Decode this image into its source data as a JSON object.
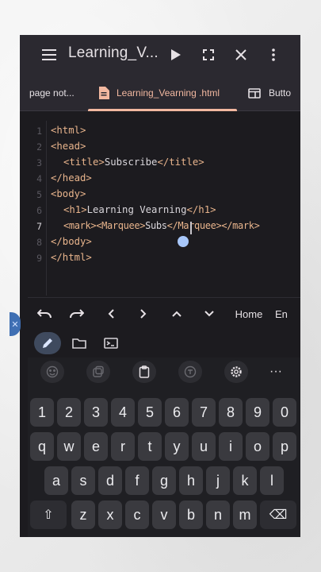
{
  "appbar": {
    "title": "Learning_V...",
    "icons": [
      "menu-icon",
      "run-icon",
      "fullscreen-icon",
      "close-icon",
      "more-vert-icon"
    ]
  },
  "tabs": [
    {
      "label": "page not..."
    },
    {
      "label": "Learning_Vearning .html",
      "active": true
    },
    {
      "label": "Butto"
    }
  ],
  "editor": {
    "line_numbers": [
      "1",
      "2",
      "3",
      "4",
      "5",
      "6",
      "7",
      "8",
      "9"
    ],
    "current_line": "7",
    "lines": [
      {
        "tags": [
          "<html>"
        ]
      },
      {
        "tags": [
          "<head>"
        ]
      },
      {
        "open": "<title>",
        "text": "Subscribe",
        "close": "</title>"
      },
      {
        "tags": [
          "</head>"
        ]
      },
      {
        "tags": [
          "<body>"
        ]
      },
      {
        "open": "<h1>",
        "text": "Learning Vearning",
        "close": "</h1>"
      },
      {
        "open": "<mark><Marquee>",
        "text": "Subs",
        "close": "</Marquee></mark>"
      },
      {
        "tags": [
          "</body>"
        ]
      },
      {
        "tags": [
          "</html>"
        ]
      }
    ]
  },
  "extra_keys": {
    "undo": "↶",
    "redo": "↷",
    "left": "<",
    "right": ">",
    "up": "^",
    "down": "v",
    "home": "Home",
    "end": "En"
  },
  "modes": [
    "edit-pencil-icon",
    "folder-icon",
    "terminal-icon"
  ],
  "keyboard": {
    "suggestion_icons": [
      "emoji-icon",
      "sticker-icon",
      "clipboard-icon",
      "translate-icon",
      "settings-icon",
      "more-horiz-icon"
    ],
    "more_label": "···",
    "row1": [
      "1",
      "2",
      "3",
      "4",
      "5",
      "6",
      "7",
      "8",
      "9",
      "0"
    ],
    "row2": [
      "q",
      "w",
      "e",
      "r",
      "t",
      "y",
      "u",
      "i",
      "o",
      "p"
    ],
    "row3": [
      "a",
      "s",
      "d",
      "f",
      "g",
      "h",
      "j",
      "k",
      "l"
    ],
    "row4": [
      "z",
      "x",
      "c",
      "v",
      "b",
      "n",
      "m"
    ],
    "shift": "⇧",
    "backspace": "⌫"
  }
}
